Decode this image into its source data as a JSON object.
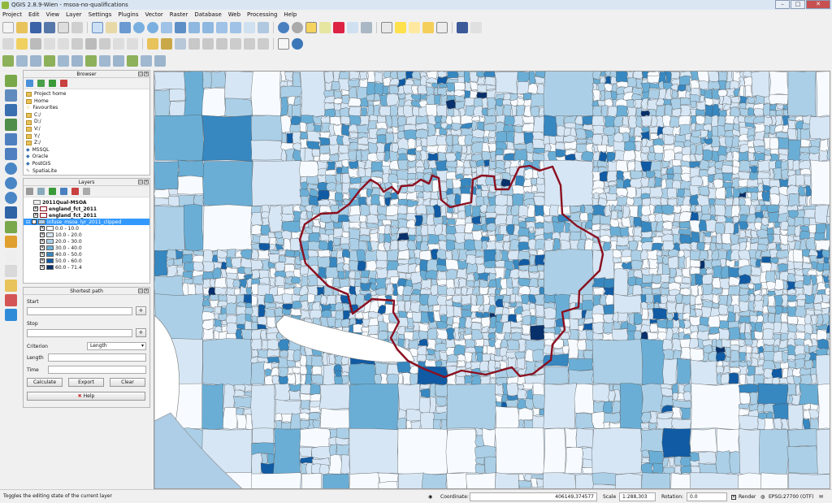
{
  "window": {
    "title": "QGIS 2.8.9-Wien - msoa-no-qualifications"
  },
  "menu": [
    "Project",
    "Edit",
    "View",
    "Layer",
    "Settings",
    "Plugins",
    "Vector",
    "Raster",
    "Database",
    "Web",
    "Processing",
    "Help"
  ],
  "browser": {
    "title": "Browser",
    "items": [
      "Project home",
      "Home",
      "Favourites",
      "C:/",
      "D:/",
      "V:/",
      "Y:/",
      "Z:/",
      "MSSQL",
      "Oracle",
      "PostGIS",
      "SpatiaLite"
    ]
  },
  "layers": {
    "title": "Layers",
    "items": [
      {
        "label": "2011Qual-MSOA",
        "bold": true
      },
      {
        "label": "england_fct_2011",
        "bold": true
      },
      {
        "label": "england_fct_2011",
        "bold": true
      },
      {
        "label": "infuse_msoa_lyr_2011_clipped",
        "bold": true,
        "selected": true
      }
    ],
    "legend": [
      {
        "label": "0.0 - 10.0",
        "color": "#f7fbff"
      },
      {
        "label": "10.0 - 20.0",
        "color": "#d6e6f4"
      },
      {
        "label": "20.0 - 30.0",
        "color": "#abcfe6"
      },
      {
        "label": "30.0 - 40.0",
        "color": "#6aaed6"
      },
      {
        "label": "40.0 - 50.0",
        "color": "#3787c0"
      },
      {
        "label": "50.0 - 60.0",
        "color": "#105ba4"
      },
      {
        "label": "60.0 - 71.4",
        "color": "#08306b"
      }
    ]
  },
  "shortest_path": {
    "title": "Shortest path",
    "start_label": "Start",
    "stop_label": "Stop",
    "criterion_label": "Criterion",
    "criterion_value": "Length",
    "length_label": "Length",
    "time_label": "Time",
    "calculate": "Calculate",
    "export": "Export",
    "clear": "Clear",
    "help": "Help"
  },
  "status": {
    "message": "Toggles the editing state of the current layer",
    "coordinate_label": "Coordinate:",
    "coordinate": "406149,374577",
    "scale_label": "Scale",
    "scale": "1:288,303",
    "rotation_label": "Rotation:",
    "rotation": "0.0",
    "render_label": "Render",
    "crs": "EPSG:27700 (OTF)"
  },
  "colors": {
    "boundary": "#8b1020",
    "accent": "#3399ff"
  }
}
